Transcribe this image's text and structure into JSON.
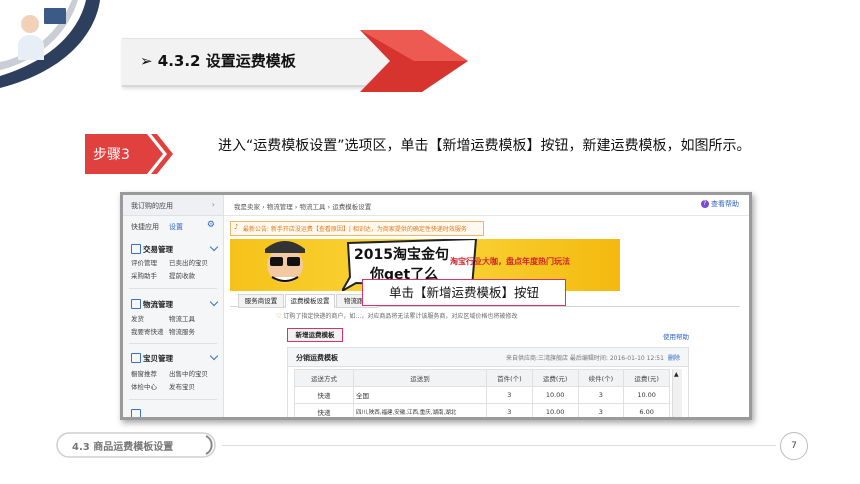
{
  "header": {
    "section_title": "➢ 4.3.2  设置运费模板"
  },
  "step": {
    "badge": "步骤3",
    "text": "进入“运费模板设置”选项区，单击【新增运费模板】按钮，新建运费模板，如图所示。"
  },
  "screenshot": {
    "sidebar": {
      "my_apps": "我订购的应用",
      "quick_apps": "快捷应用",
      "quick_apps_link": "设置",
      "sections": [
        {
          "title": "交易管理",
          "items": [
            "评价管理",
            "已卖出的宝贝",
            "采购助手",
            "提前收款"
          ]
        },
        {
          "title": "物流管理",
          "items": [
            "发货",
            "物流工具",
            "我要寄快递",
            "物流服务"
          ]
        },
        {
          "title": "宝贝管理",
          "items": [
            "橱窗推荐",
            "出售中的宝贝",
            "体检中心",
            "发布宝贝"
          ]
        }
      ]
    },
    "breadcrumb": "我是卖家 › 物流管理 › 物流工具 › 运费模板设置",
    "help_link": "查看帮助",
    "notice": "最新公告: 新手开店没运费【查看原因】| 相训达，为商家提供的确定性快递时效服务",
    "banner": {
      "title_line1": "2015淘宝金句",
      "title_line2": "你get了么",
      "subtitle": "淘宝行业大咖，盘点年度热门玩法"
    },
    "tabs": [
      "服务商设置",
      "运费模板设置",
      "物流跟踪"
    ],
    "tip": "订购了指定快递的商户，如…，对应商品将无法累计该服务商，对应区域价格也将被修改",
    "add_template_button": "新增运费模板",
    "usage_help": "使用帮助",
    "template": {
      "name": "分销运费模板",
      "meta": "来自供应商:三湾旗舰店 最后编辑时间: 2016-01-10 12:51",
      "delete_link": "删除",
      "columns": [
        "运送方式",
        "运送到",
        "首件(个)",
        "运费(元)",
        "续件(个)",
        "运费(元)"
      ],
      "rows": [
        [
          "快递",
          "全国",
          "3",
          "10.00",
          "3",
          "10.00"
        ],
        [
          "快递",
          "四川,陕西,福建,安徽,江西,重庆,湖南,湖北",
          "3",
          "10.00",
          "3",
          "6.00"
        ]
      ]
    }
  },
  "callout": "单击【新增运费模板】按钮",
  "footer": {
    "section_label": "4.3  商品运费模板设置",
    "page_number": "7"
  },
  "colors": {
    "accent_red": "#e0413f",
    "orange_notice": "#e07b1a",
    "callout_border": "#d6336c",
    "link_blue": "#2f62c6"
  }
}
